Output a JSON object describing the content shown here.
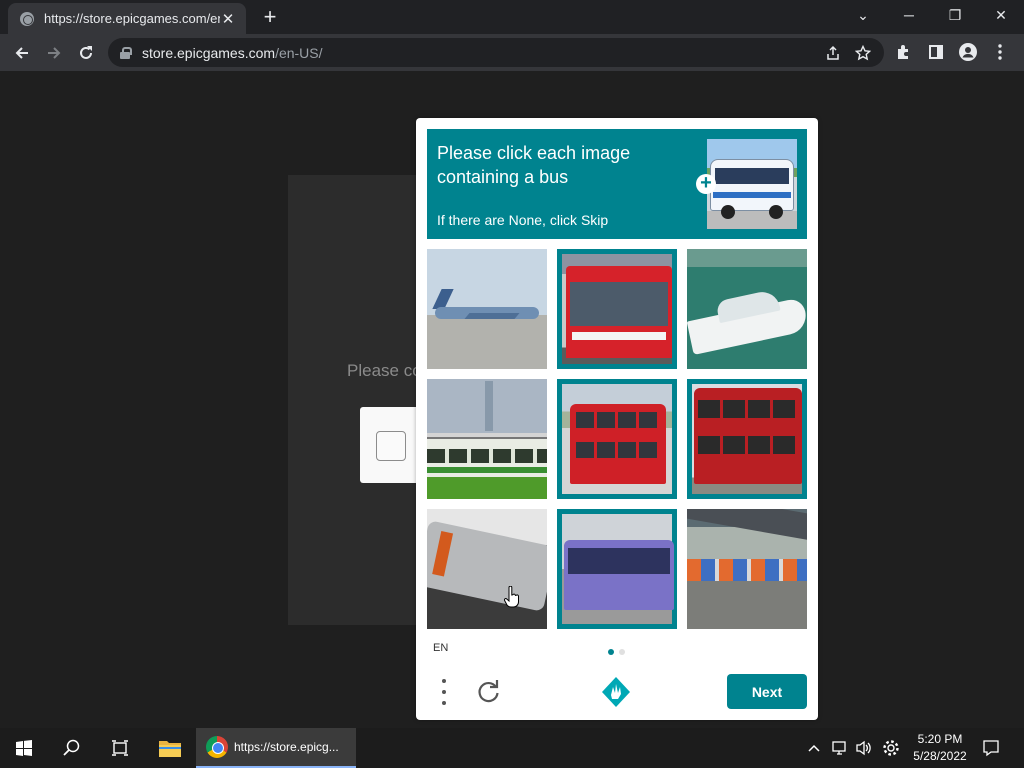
{
  "browser": {
    "tab_title": "https://store.epicgames.com/en-",
    "url_host": "store.epicgames.com",
    "url_path": "/en-US/"
  },
  "page": {
    "background_prompt": "Please co"
  },
  "captcha": {
    "prompt": "Please click each image containing a bus",
    "hint": "If there are None, click Skip",
    "sample_icon": "bus-sample-image",
    "tiles": [
      {
        "content": "airplane",
        "selected": false
      },
      {
        "content": "red-bus",
        "selected": true
      },
      {
        "content": "boat",
        "selected": false
      },
      {
        "content": "green-train",
        "selected": false
      },
      {
        "content": "double-decker-bus",
        "selected": true
      },
      {
        "content": "double-decker-bus",
        "selected": true
      },
      {
        "content": "gray-train",
        "selected": false
      },
      {
        "content": "blue-bus",
        "selected": true
      },
      {
        "content": "train-station",
        "selected": false
      }
    ],
    "page_indicator": {
      "count": 2,
      "current": 1
    },
    "language": "EN",
    "next_label": "Next",
    "accent_color": "#00838f"
  },
  "taskbar": {
    "chrome_label": "https://store.epicg...",
    "time": "5:20 PM",
    "date": "5/28/2022"
  }
}
